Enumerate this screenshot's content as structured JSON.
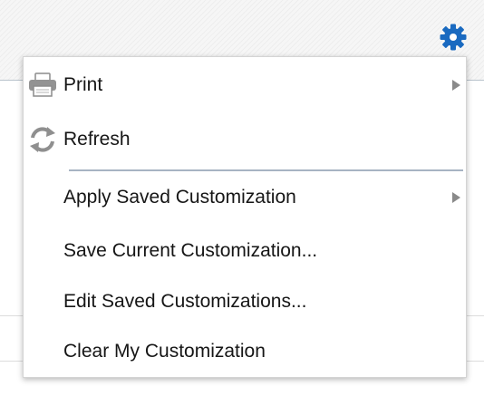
{
  "header": {
    "settings_icon": "gear-icon",
    "accent_color": "#1a6ac0"
  },
  "menu": {
    "items": [
      {
        "label": "Print",
        "icon": "printer-icon",
        "has_submenu": true
      },
      {
        "label": "Refresh",
        "icon": "refresh-icon",
        "has_submenu": false
      },
      {
        "label": "Apply Saved Customization",
        "icon": null,
        "has_submenu": true
      },
      {
        "label": "Save Current Customization...",
        "icon": null,
        "has_submenu": false
      },
      {
        "label": "Edit Saved Customizations...",
        "icon": null,
        "has_submenu": false
      },
      {
        "label": "Clear My Customization",
        "icon": null,
        "has_submenu": false
      }
    ]
  }
}
